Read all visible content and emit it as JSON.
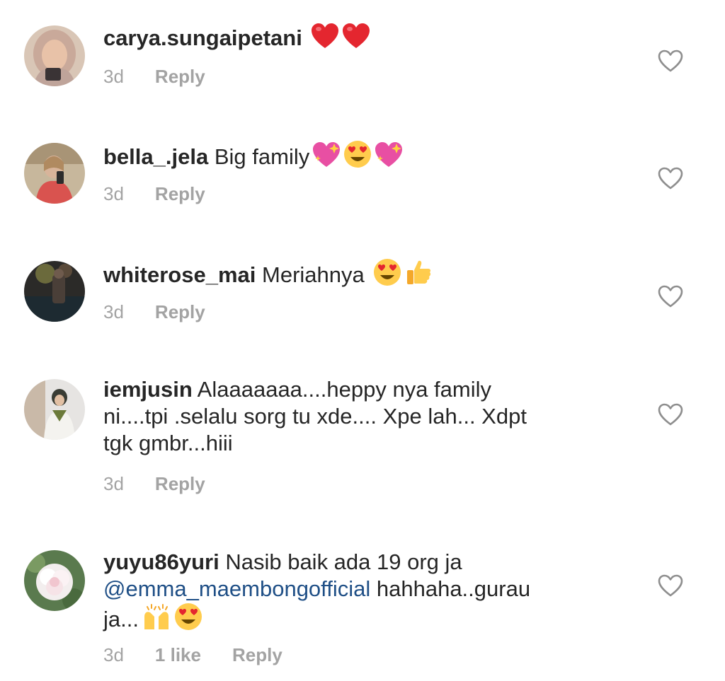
{
  "comments": [
    {
      "username": "carya.sungaipetani",
      "text": "",
      "emojis": [
        "red-heart",
        "red-heart"
      ],
      "time": "3d",
      "likes": "",
      "reply": "Reply"
    },
    {
      "username": "bella_.jela",
      "text": "Big family",
      "emojis": [
        "sparkling-heart",
        "heart-eyes",
        "sparkling-heart"
      ],
      "time": "3d",
      "likes": "",
      "reply": "Reply"
    },
    {
      "username": "whiterose_mai",
      "text": "Meriahnya",
      "emojis": [
        "heart-eyes",
        "thumbs-up"
      ],
      "time": "3d",
      "likes": "",
      "reply": "Reply"
    },
    {
      "username": "iemjusin",
      "text_line1": "Alaaaaaaa....heppy nya family",
      "text_line2": "ni....tpi .selalu sorg tu xde.... Xpe lah... Xdpt",
      "text_line3": "tgk gmbr...hiii",
      "time": "3d",
      "likes": "",
      "reply": "Reply"
    },
    {
      "username": "yuyu86yuri",
      "text_line1": "Nasib baik ada 19 org ja",
      "mention": "@emma_maembongofficial",
      "text_line2": "hahhaha..gurau",
      "text_line3": "ja...",
      "emojis": [
        "raising-hands",
        "heart-eyes"
      ],
      "time": "3d",
      "likes": "1 like",
      "reply": "Reply"
    }
  ],
  "colors": {
    "text": "#262626",
    "meta": "#a3a3a3",
    "mention": "#1f4f86",
    "heart_outline": "#8e8e8e"
  },
  "icons": {
    "like": "heart-outline-icon"
  }
}
